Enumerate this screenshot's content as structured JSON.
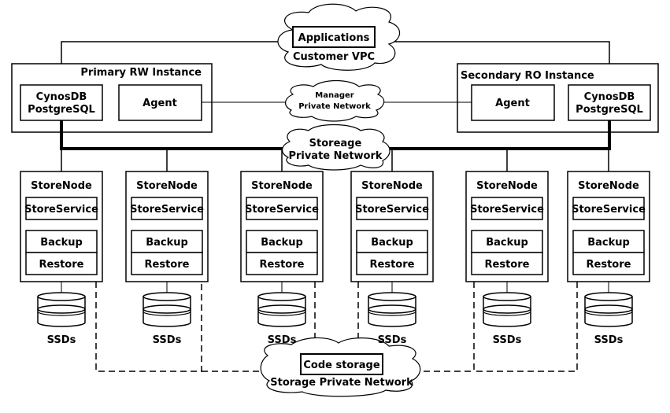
{
  "diagram": {
    "customer_vpc": {
      "label": "Customer VPC",
      "applications_label": "Applications"
    },
    "primary_instance": {
      "title": "Primary RW Instance",
      "db_line1": "CynosDB",
      "db_line2": "PostgreSQL",
      "agent_label": "Agent"
    },
    "secondary_instance": {
      "title": "Secondary RO Instance",
      "db_line1": "CynosDB",
      "db_line2": "PostgreSQL",
      "agent_label": "Agent"
    },
    "manager_network": {
      "line1": "Manager",
      "line2": "Private Network"
    },
    "storage_network_top": {
      "line1": "Storeage",
      "line2": "Private Network"
    },
    "store_nodes": [
      {
        "title": "StoreNode",
        "service": "StoreService",
        "backup": "Backup",
        "restore": "Restore",
        "disk_label": "SSDs"
      },
      {
        "title": "StoreNode",
        "service": "StoreService",
        "backup": "Backup",
        "restore": "Restore",
        "disk_label": "SSDs"
      },
      {
        "title": "StoreNode",
        "service": "StoreService",
        "backup": "Backup",
        "restore": "Restore",
        "disk_label": "SSDs"
      },
      {
        "title": "StoreNode",
        "service": "StoreService",
        "backup": "Backup",
        "restore": "Restore",
        "disk_label": "SSDs"
      },
      {
        "title": "StoreNode",
        "service": "StoreService",
        "backup": "Backup",
        "restore": "Restore",
        "disk_label": "SSDs"
      },
      {
        "title": "StoreNode",
        "service": "StoreService",
        "backup": "Backup",
        "restore": "Restore",
        "disk_label": "SSDs"
      }
    ],
    "code_storage": {
      "box_label": "Code storage",
      "network_label": "Storage Private Network"
    }
  }
}
